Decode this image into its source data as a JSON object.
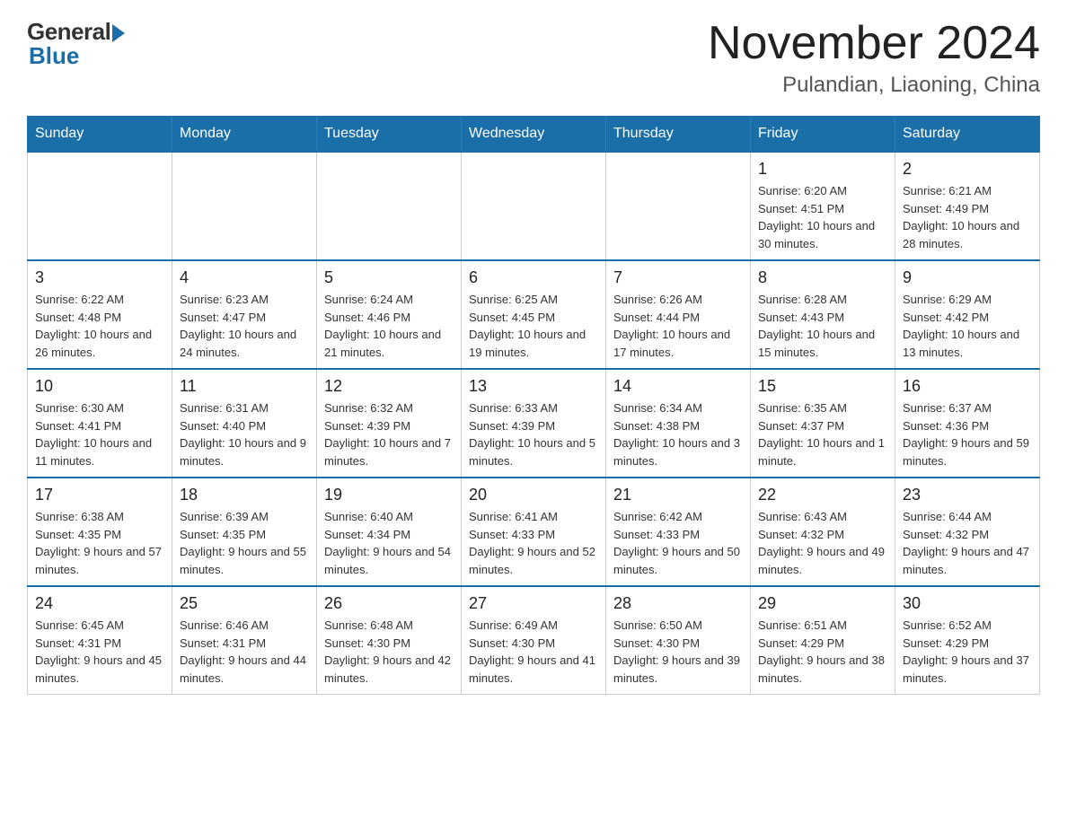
{
  "header": {
    "logo_general": "General",
    "logo_blue": "Blue",
    "month_year": "November 2024",
    "location": "Pulandian, Liaoning, China"
  },
  "weekdays": [
    "Sunday",
    "Monday",
    "Tuesday",
    "Wednesday",
    "Thursday",
    "Friday",
    "Saturday"
  ],
  "weeks": [
    [
      {
        "day": "",
        "info": ""
      },
      {
        "day": "",
        "info": ""
      },
      {
        "day": "",
        "info": ""
      },
      {
        "day": "",
        "info": ""
      },
      {
        "day": "",
        "info": ""
      },
      {
        "day": "1",
        "info": "Sunrise: 6:20 AM\nSunset: 4:51 PM\nDaylight: 10 hours and 30 minutes."
      },
      {
        "day": "2",
        "info": "Sunrise: 6:21 AM\nSunset: 4:49 PM\nDaylight: 10 hours and 28 minutes."
      }
    ],
    [
      {
        "day": "3",
        "info": "Sunrise: 6:22 AM\nSunset: 4:48 PM\nDaylight: 10 hours and 26 minutes."
      },
      {
        "day": "4",
        "info": "Sunrise: 6:23 AM\nSunset: 4:47 PM\nDaylight: 10 hours and 24 minutes."
      },
      {
        "day": "5",
        "info": "Sunrise: 6:24 AM\nSunset: 4:46 PM\nDaylight: 10 hours and 21 minutes."
      },
      {
        "day": "6",
        "info": "Sunrise: 6:25 AM\nSunset: 4:45 PM\nDaylight: 10 hours and 19 minutes."
      },
      {
        "day": "7",
        "info": "Sunrise: 6:26 AM\nSunset: 4:44 PM\nDaylight: 10 hours and 17 minutes."
      },
      {
        "day": "8",
        "info": "Sunrise: 6:28 AM\nSunset: 4:43 PM\nDaylight: 10 hours and 15 minutes."
      },
      {
        "day": "9",
        "info": "Sunrise: 6:29 AM\nSunset: 4:42 PM\nDaylight: 10 hours and 13 minutes."
      }
    ],
    [
      {
        "day": "10",
        "info": "Sunrise: 6:30 AM\nSunset: 4:41 PM\nDaylight: 10 hours and 11 minutes."
      },
      {
        "day": "11",
        "info": "Sunrise: 6:31 AM\nSunset: 4:40 PM\nDaylight: 10 hours and 9 minutes."
      },
      {
        "day": "12",
        "info": "Sunrise: 6:32 AM\nSunset: 4:39 PM\nDaylight: 10 hours and 7 minutes."
      },
      {
        "day": "13",
        "info": "Sunrise: 6:33 AM\nSunset: 4:39 PM\nDaylight: 10 hours and 5 minutes."
      },
      {
        "day": "14",
        "info": "Sunrise: 6:34 AM\nSunset: 4:38 PM\nDaylight: 10 hours and 3 minutes."
      },
      {
        "day": "15",
        "info": "Sunrise: 6:35 AM\nSunset: 4:37 PM\nDaylight: 10 hours and 1 minute."
      },
      {
        "day": "16",
        "info": "Sunrise: 6:37 AM\nSunset: 4:36 PM\nDaylight: 9 hours and 59 minutes."
      }
    ],
    [
      {
        "day": "17",
        "info": "Sunrise: 6:38 AM\nSunset: 4:35 PM\nDaylight: 9 hours and 57 minutes."
      },
      {
        "day": "18",
        "info": "Sunrise: 6:39 AM\nSunset: 4:35 PM\nDaylight: 9 hours and 55 minutes."
      },
      {
        "day": "19",
        "info": "Sunrise: 6:40 AM\nSunset: 4:34 PM\nDaylight: 9 hours and 54 minutes."
      },
      {
        "day": "20",
        "info": "Sunrise: 6:41 AM\nSunset: 4:33 PM\nDaylight: 9 hours and 52 minutes."
      },
      {
        "day": "21",
        "info": "Sunrise: 6:42 AM\nSunset: 4:33 PM\nDaylight: 9 hours and 50 minutes."
      },
      {
        "day": "22",
        "info": "Sunrise: 6:43 AM\nSunset: 4:32 PM\nDaylight: 9 hours and 49 minutes."
      },
      {
        "day": "23",
        "info": "Sunrise: 6:44 AM\nSunset: 4:32 PM\nDaylight: 9 hours and 47 minutes."
      }
    ],
    [
      {
        "day": "24",
        "info": "Sunrise: 6:45 AM\nSunset: 4:31 PM\nDaylight: 9 hours and 45 minutes."
      },
      {
        "day": "25",
        "info": "Sunrise: 6:46 AM\nSunset: 4:31 PM\nDaylight: 9 hours and 44 minutes."
      },
      {
        "day": "26",
        "info": "Sunrise: 6:48 AM\nSunset: 4:30 PM\nDaylight: 9 hours and 42 minutes."
      },
      {
        "day": "27",
        "info": "Sunrise: 6:49 AM\nSunset: 4:30 PM\nDaylight: 9 hours and 41 minutes."
      },
      {
        "day": "28",
        "info": "Sunrise: 6:50 AM\nSunset: 4:30 PM\nDaylight: 9 hours and 39 minutes."
      },
      {
        "day": "29",
        "info": "Sunrise: 6:51 AM\nSunset: 4:29 PM\nDaylight: 9 hours and 38 minutes."
      },
      {
        "day": "30",
        "info": "Sunrise: 6:52 AM\nSunset: 4:29 PM\nDaylight: 9 hours and 37 minutes."
      }
    ]
  ]
}
